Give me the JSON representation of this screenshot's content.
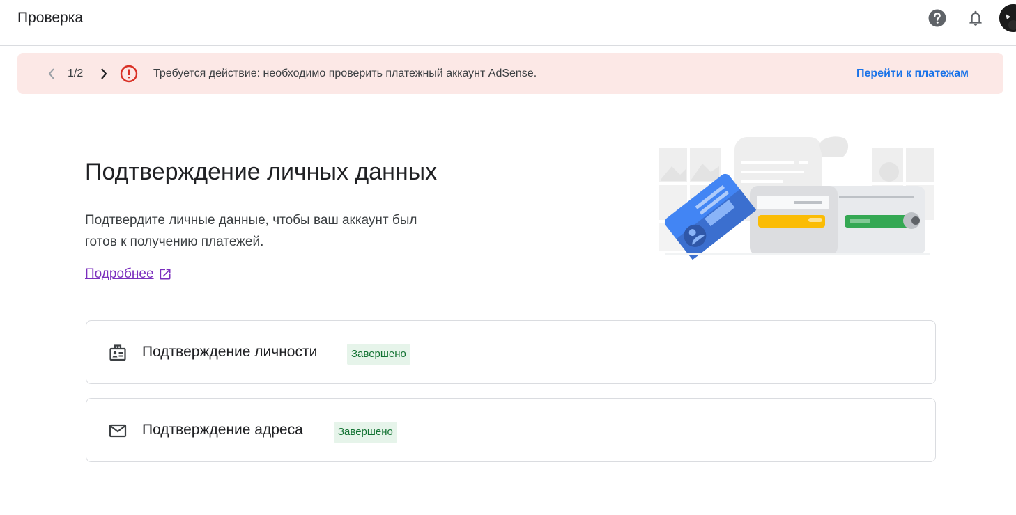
{
  "header": {
    "title": "Проверка",
    "help_icon": "help-circle-icon",
    "bell_icon": "bell-icon"
  },
  "banner": {
    "pager": "1/2",
    "message": "Требуется действие: необходимо проверить платежный аккаунт AdSense.",
    "action_link": "Перейти к платежам"
  },
  "main": {
    "heading": "Подтверждение личных данных",
    "description": "Подтвердите личные данные, чтобы ваш аккаунт был готов к получению платежей.",
    "learn_more": "Подробнее"
  },
  "verifications": [
    {
      "title": "Подтверждение личности",
      "status": "Завершено",
      "icon": "id-badge-icon"
    },
    {
      "title": "Подтверждение адреса",
      "status": "Завершено",
      "icon": "mail-icon"
    }
  ],
  "colors": {
    "banner_bg": "#fce8e6",
    "error_red": "#d93025",
    "link_blue": "#1a73e8",
    "visited_link": "#7b2fbe",
    "badge_bg": "#e6f4ea",
    "badge_text": "#137333"
  }
}
